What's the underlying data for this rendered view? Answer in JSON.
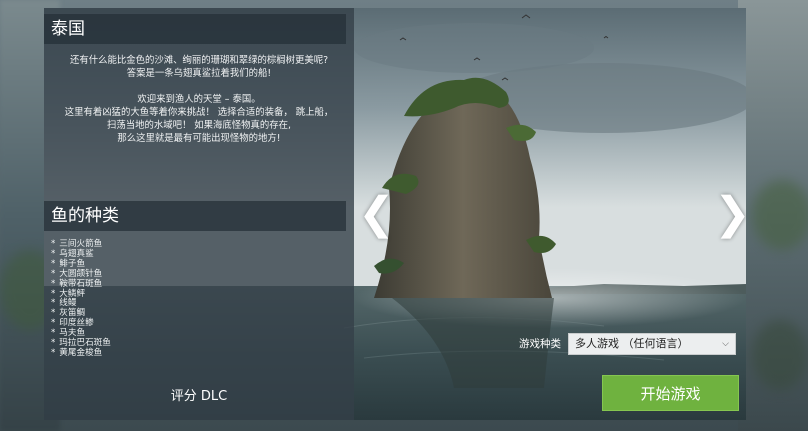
{
  "location": {
    "title": "泰国",
    "description": [
      "还有什么能比金色的沙滩、绚丽的珊瑚和翠绿的棕榈树更美呢?",
      "答案是一条乌翅真鲨拉着我们的船!",
      "",
      "欢迎来到渔人的天堂 – 泰国。",
      "这里有着凶猛的大鱼等着你来挑战！ 选择合适的装备， 跳上船，",
      "扫荡当地的水域吧！ 如果海底怪物真的存在,",
      "那么这里就是最有可能出现怪物的地方!"
    ]
  },
  "fish_section": {
    "title": "鱼的种类",
    "items": [
      "三间火箭鱼",
      "乌翅真鲨",
      "鲱子鱼",
      "大圆颌针鱼",
      "鞍带石斑鱼",
      "大鳞鲆",
      "线鳗",
      "灰笛鲷",
      "印度丝鲹",
      "马夫鱼",
      "玛拉巴石斑鱼",
      "黄尾金梭鱼"
    ]
  },
  "rating": {
    "label": "评分",
    "value": "DLC"
  },
  "nav": {
    "prev_glyph": "❮",
    "next_glyph": "❯"
  },
  "game_mode": {
    "label": "游戏种类",
    "selected": "多人游戏 （任何语言）"
  },
  "start_button": {
    "label": "开始游戏"
  },
  "colors": {
    "start_button": "#6fb23f",
    "panel": "#344048"
  }
}
